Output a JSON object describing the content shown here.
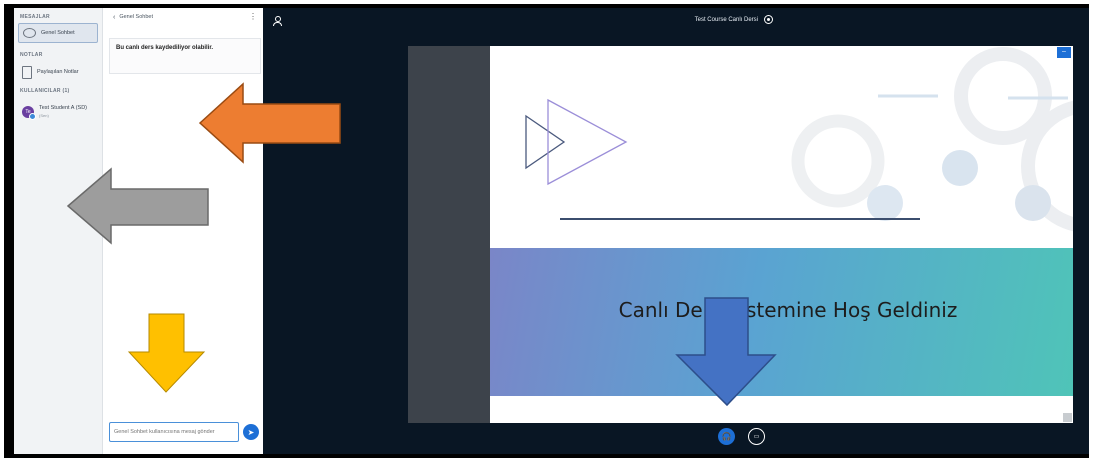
{
  "sidebar": {
    "messages_heading": "MESAJLAR",
    "chat_item_label": "Genel Sohbet",
    "notes_heading": "NOTLAR",
    "notes_item_label": "Paylaşılan Notlar",
    "users_heading": "KULLANICILAR (1)",
    "user": {
      "initials": "Te",
      "name": "Test Student A (SD)",
      "status": "(Sen)"
    }
  },
  "chat": {
    "title": "Genel Sohbet",
    "notice": "Bu canlı ders kaydediliyor olabilir.",
    "input_placeholder": "Genel Sohbet kullanıcısına mesaj gönder"
  },
  "stage": {
    "session_title": "Test Course Canlı Dersi",
    "slide_text": "Canlı Ders Sistemine Hoş Geldiniz"
  },
  "annotations": {
    "arrow_colors": {
      "orange": "#ed7d31",
      "gray": "#9d9d9d",
      "yellow": "#ffc000",
      "blue": "#4472c4"
    }
  },
  "colors": {
    "accent": "#1d6fd6",
    "stage_bg": "#091624",
    "sidebar_bg": "#f1f3f5"
  }
}
